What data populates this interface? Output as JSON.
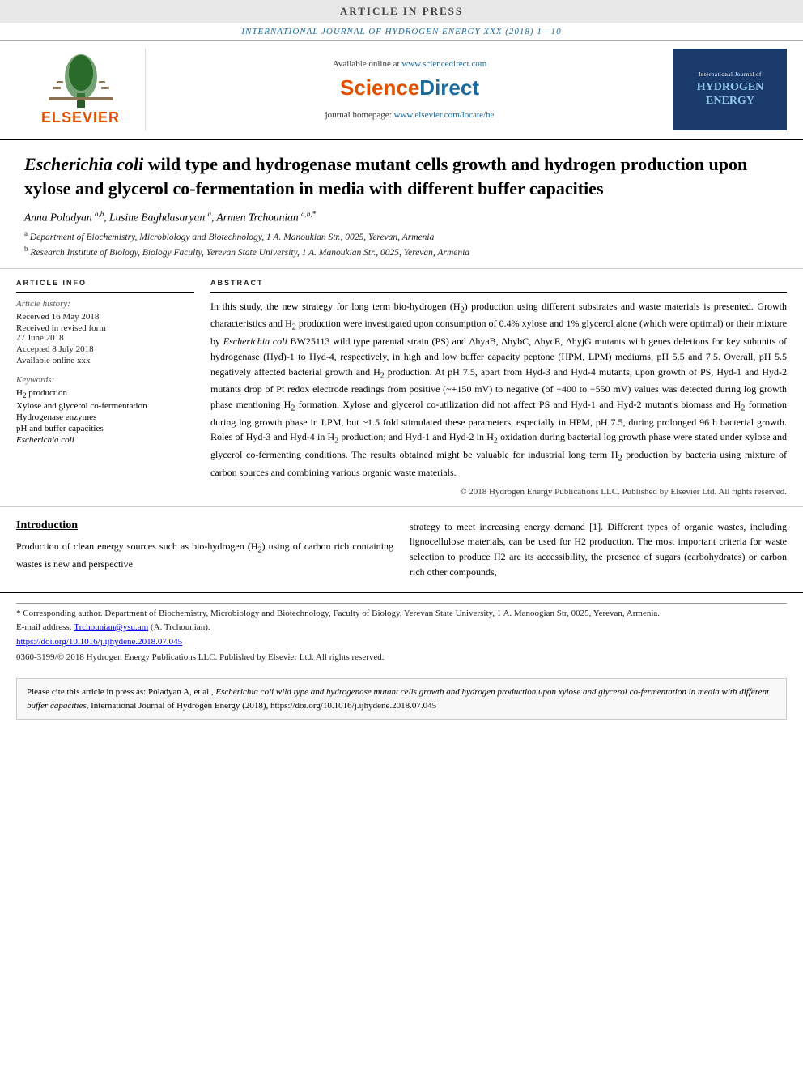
{
  "banner": {
    "text": "ARTICLE IN PRESS"
  },
  "journal_header": {
    "text": "INTERNATIONAL JOURNAL OF HYDROGEN ENERGY XXX (2018) 1—10"
  },
  "elsevier": {
    "brand": "ELSEVIER",
    "available_online_prefix": "Available online at",
    "available_online_url": "www.sciencedirect.com",
    "sciencedirect_label": "ScienceDirect",
    "journal_homepage_prefix": "journal homepage:",
    "journal_homepage_url": "www.elsevier.com/locate/he"
  },
  "hydrogen_energy_journal": {
    "intl_text": "International Journal of",
    "journal_name": "HYDROGEN\nENERGY"
  },
  "article": {
    "title": "Escherichia coli wild type and hydrogenase mutant cells growth and hydrogen production upon xylose and glycerol co-fermentation in media with different buffer capacities",
    "authors": "Anna Poladyan a,b, Lusine Baghdasaryan a, Armen Trchounian a,b,*",
    "affiliations": [
      "a Department of Biochemistry, Microbiology and Biotechnology, 1 A. Manoukian Str., 0025, Yerevan, Armenia",
      "b Research Institute of Biology, Biology Faculty, Yerevan State University, 1 A. Manoukian Str., 0025, Yerevan, Armenia"
    ]
  },
  "article_info": {
    "section_label": "ARTICLE INFO",
    "history_label": "Article history:",
    "received": "Received 16 May 2018",
    "received_revised": "Received in revised form 27 June 2018",
    "accepted": "Accepted 8 July 2018",
    "available": "Available online xxx",
    "keywords_label": "Keywords:",
    "keywords": [
      "H2 production",
      "Xylose and glycerol co-fermentation",
      "Hydrogenase enzymes",
      "pH and buffer capacities",
      "Escherichia coli"
    ]
  },
  "abstract": {
    "section_label": "ABSTRACT",
    "text": "In this study, the new strategy for long term bio-hydrogen (H2) production using different substrates and waste materials is presented. Growth characteristics and H2 production were investigated upon consumption of 0.4% xylose and 1% glycerol alone (which were optimal) or their mixture by Escherichia coli BW25113 wild type parental strain (PS) and ΔhyaB, ΔhybC, ΔhycE, ΔhyjG mutants with genes deletions for key subunits of hydrogenase (Hyd)-1 to Hyd-4, respectively, in high and low buffer capacity peptone (HPM, LPM) mediums, pH 5.5 and 7.5. Overall, pH 5.5 negatively affected bacterial growth and H2 production. At pH 7.5, apart from Hyd-3 and Hyd-4 mutants, upon growth of PS, Hyd-1 and Hyd-2 mutants drop of Pt redox electrode readings from positive (~+150 mV) to negative (of −400 to −550 mV) values was detected during log growth phase mentioning H2 formation. Xylose and glycerol co-utilization did not affect PS and Hyd-1 and Hyd-2 mutant's biomass and H2 formation during log growth phase in LPM, but ~1.5 fold stimulated these parameters, especially in HPM, pH 7.5, during prolonged 96 h bacterial growth. Roles of Hyd-3 and Hyd-4 in H2 production; and Hyd-1 and Hyd-2 in H2 oxidation during bacterial log growth phase were stated under xylose and glycerol co-fermenting conditions. The results obtained might be valuable for industrial long term H2 production by bacteria using mixture of carbon sources and combining various organic waste materials.",
    "copyright": "© 2018 Hydrogen Energy Publications LLC. Published by Elsevier Ltd. All rights reserved."
  },
  "introduction": {
    "heading": "Introduction",
    "left_text": "Production of clean energy sources such as bio-hydrogen (H2) using of carbon rich containing wastes is new and perspective",
    "right_text": "strategy to meet increasing energy demand [1]. Different types of organic wastes, including lignocellulose materials, can be used for H2 production. The most important criteria for waste selection to produce H2 are its accessibility, the presence of sugars (carbohydrates) or carbon rich other compounds,"
  },
  "footnotes": {
    "corresponding_author": "* Corresponding author. Department of Biochemistry, Microbiology and Biotechnology, Faculty of Biology, Yerevan State University, 1 A. Manoogian Str, 0025, Yerevan, Armenia.",
    "email_label": "E-mail address:",
    "email": "Trchounian@ysu.am",
    "email_suffix": "(A. Trchounian).",
    "doi": "https://doi.org/10.1016/j.ijhydene.2018.07.045",
    "issn": "0360-3199/© 2018 Hydrogen Energy Publications LLC. Published by Elsevier Ltd. All rights reserved."
  },
  "citation": {
    "prefix": "Please cite this article in press as: Poladyan A, et al.,",
    "italic_part": "Escherichia coli wild type and hydrogenase mutant cells growth and hydrogen production upon xylose and glycerol co-fermentation in media with different buffer capacities,",
    "suffix": "International Journal of Hydrogen Energy (2018), https://doi.org/10.1016/j.ijhydene.2018.07.045"
  }
}
